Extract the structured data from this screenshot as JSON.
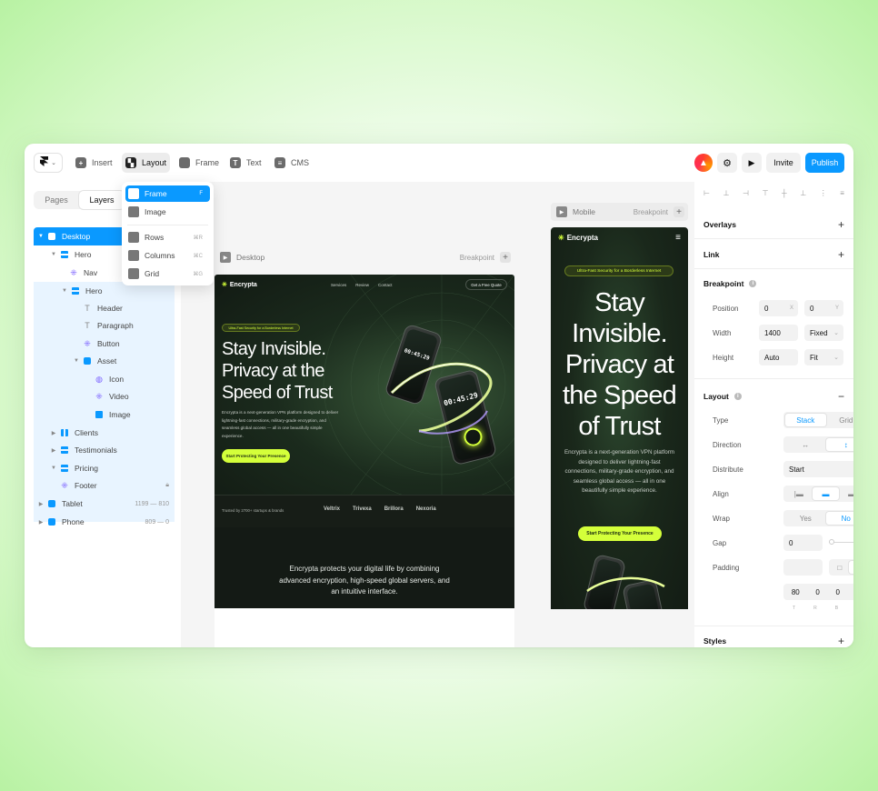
{
  "toolbar": {
    "logo_icon": "framer-logo-icon",
    "tools": [
      {
        "label": "Insert",
        "icon": "plus-icon"
      },
      {
        "label": "Layout",
        "icon": "layout-icon"
      },
      {
        "label": "Frame",
        "icon": "frame-icon"
      },
      {
        "label": "Text",
        "icon": "text-icon"
      },
      {
        "label": "CMS",
        "icon": "database-icon"
      }
    ],
    "invite_label": "Invite",
    "publish_label": "Publish",
    "accent_color": "#0a99ff"
  },
  "layout_menu": {
    "items": [
      {
        "label": "Frame",
        "shortcut": "F"
      },
      {
        "label": "Image",
        "shortcut": ""
      },
      {
        "label": "Rows",
        "shortcut": "⌘R"
      },
      {
        "label": "Columns",
        "shortcut": "⌘C"
      },
      {
        "label": "Grid",
        "shortcut": "⌘G"
      }
    ]
  },
  "left_panel": {
    "tabs": [
      "Pages",
      "Layers"
    ],
    "active_tab": "Layers",
    "layers": [
      {
        "label": "Desktop",
        "meta": ""
      },
      {
        "label": "Hero",
        "meta": ""
      },
      {
        "label": "Nav",
        "meta": ""
      },
      {
        "label": "Hero",
        "meta": ""
      },
      {
        "label": "Header",
        "meta": ""
      },
      {
        "label": "Paragraph",
        "meta": ""
      },
      {
        "label": "Button",
        "meta": ""
      },
      {
        "label": "Asset",
        "meta": ""
      },
      {
        "label": "Icon",
        "meta": ""
      },
      {
        "label": "Video",
        "meta": ""
      },
      {
        "label": "Image",
        "meta": ""
      },
      {
        "label": "Clients",
        "meta": ""
      },
      {
        "label": "Testimonials",
        "meta": ""
      },
      {
        "label": "Pricing",
        "meta": ""
      },
      {
        "label": "Footer",
        "meta": ""
      },
      {
        "label": "Tablet",
        "meta": "1199 — 810"
      },
      {
        "label": "Phone",
        "meta": "809 — 0"
      }
    ]
  },
  "canvas": {
    "desktop_bar": {
      "title": "Desktop",
      "breakpoint_label": "Breakpoint"
    },
    "mobile_bar": {
      "title": "Mobile",
      "breakpoint_label": "Breakpoint"
    },
    "site": {
      "brand": "Encrypta",
      "nav_links": [
        "Services",
        "Review",
        "Contact"
      ],
      "nav_cta": "Get a Free Quote",
      "badge": "Ultra-Fast Security for a Borderless Internet",
      "headline_desktop": "Stay Invisible. Privacy at the Speed of Trust",
      "headline_mobile": "Stay Invisible. Privacy at the Speed of Trust",
      "body_desktop": "Encrypta is a next-generation VPN platform designed to deliver lightning-fast connections, military-grade encryption, and seamless global access — all in one beautifully simple experience.",
      "body_mobile": "Encrypta is a next-generation VPN platform designed to deliver lightning-fast connections, military-grade encryption, and seamless global access — all in one beautifully simple experience.",
      "cta": "Start Protecting Your Presence",
      "phone_time_1": "00:45:29",
      "phone_time_2": "00:45:29",
      "trusted_by": "Trusted by 2700+ startups & brands",
      "logos": [
        "Veltrix",
        "Trivexa",
        "Brillora",
        "Nexoria"
      ],
      "mission": "Encrypta protects your digital life by combining advanced encryption, high-speed global servers, and an intuitive interface.",
      "highlight_color": "#d4ff3a"
    }
  },
  "right_panel": {
    "sections": {
      "overlays": "Overlays",
      "link": "Link",
      "breakpoint": "Breakpoint",
      "layout": "Layout",
      "styles": "Styles"
    },
    "breakpoint": {
      "position_label": "Position",
      "position_x": "0",
      "position_x_suffix": "X",
      "position_y": "0",
      "position_y_suffix": "Y",
      "width_label": "Width",
      "width": "1400",
      "width_mode": "Fixed",
      "height_label": "Height",
      "height": "Auto",
      "height_mode": "Fit"
    },
    "layout": {
      "type_label": "Type",
      "type_options": [
        "Stack",
        "Grid"
      ],
      "type_selected": "Stack",
      "direction_label": "Direction",
      "distribute_label": "Distribute",
      "distribute": "Start",
      "align_label": "Align",
      "wrap_label": "Wrap",
      "wrap_options": [
        "Yes",
        "No"
      ],
      "wrap_selected": "No",
      "gap_label": "Gap",
      "gap": "0",
      "padding_label": "Padding",
      "padding_values": [
        "80",
        "0",
        "0",
        "0"
      ],
      "padding_sides": [
        "T",
        "R",
        "B",
        "L"
      ]
    }
  }
}
